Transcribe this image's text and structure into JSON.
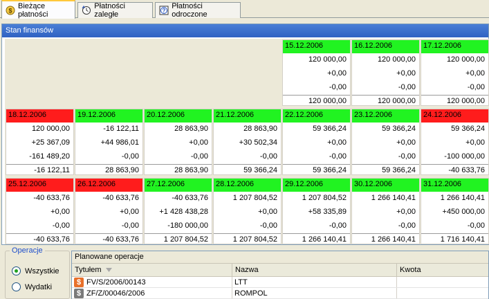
{
  "tabs": [
    {
      "label": "Bieżące płatności",
      "icon": "dollar-circle-icon"
    },
    {
      "label": "Płatności zaległe",
      "icon": "clock-arrow-icon"
    },
    {
      "label": "Płatności odroczone",
      "icon": "question-clock-icon"
    }
  ],
  "panel": {
    "title": "Stan finansów"
  },
  "days": [
    {
      "date": "15.12.2006",
      "status": "green",
      "start": "120 000,00",
      "inflow": "+0,00",
      "outflow": "-0,00",
      "end": "120 000,00"
    },
    {
      "date": "16.12.2006",
      "status": "green",
      "start": "120 000,00",
      "inflow": "+0,00",
      "outflow": "-0,00",
      "end": "120 000,00"
    },
    {
      "date": "17.12.2006",
      "status": "green",
      "start": "120 000,00",
      "inflow": "+0,00",
      "outflow": "-0,00",
      "end": "120 000,00"
    },
    {
      "date": "18.12.2006",
      "status": "red",
      "start": "120 000,00",
      "inflow": "+25 367,09",
      "outflow": "-161 489,20",
      "end": "-16 122,11"
    },
    {
      "date": "19.12.2006",
      "status": "green",
      "start": "-16 122,11",
      "inflow": "+44 986,01",
      "outflow": "-0,00",
      "end": "28 863,90"
    },
    {
      "date": "20.12.2006",
      "status": "green",
      "start": "28 863,90",
      "inflow": "+0,00",
      "outflow": "-0,00",
      "end": "28 863,90"
    },
    {
      "date": "21.12.2006",
      "status": "green",
      "start": "28 863,90",
      "inflow": "+30 502,34",
      "outflow": "-0,00",
      "end": "59 366,24"
    },
    {
      "date": "22.12.2006",
      "status": "green",
      "start": "59 366,24",
      "inflow": "+0,00",
      "outflow": "-0,00",
      "end": "59 366,24"
    },
    {
      "date": "23.12.2006",
      "status": "green",
      "start": "59 366,24",
      "inflow": "+0,00",
      "outflow": "-0,00",
      "end": "59 366,24"
    },
    {
      "date": "24.12.2006",
      "status": "red",
      "start": "59 366,24",
      "inflow": "+0,00",
      "outflow": "-100 000,00",
      "end": "-40 633,76"
    },
    {
      "date": "25.12.2006",
      "status": "red",
      "start": "-40 633,76",
      "inflow": "+0,00",
      "outflow": "-0,00",
      "end": "-40 633,76"
    },
    {
      "date": "26.12.2006",
      "status": "red",
      "start": "-40 633,76",
      "inflow": "+0,00",
      "outflow": "-0,00",
      "end": "-40 633,76"
    },
    {
      "date": "27.12.2006",
      "status": "green",
      "start": "-40 633,76",
      "inflow": "+1 428 438,28",
      "outflow": "-180 000,00",
      "end": "1 207 804,52"
    },
    {
      "date": "28.12.2006",
      "status": "green",
      "start": "1 207 804,52",
      "inflow": "+0,00",
      "outflow": "-0,00",
      "end": "1 207 804,52"
    },
    {
      "date": "29.12.2006",
      "status": "green",
      "start": "1 207 804,52",
      "inflow": "+58 335,89",
      "outflow": "-0,00",
      "end": "1 266 140,41"
    },
    {
      "date": "30.12.2006",
      "status": "green",
      "start": "1 266 140,41",
      "inflow": "+0,00",
      "outflow": "-0,00",
      "end": "1 266 140,41"
    },
    {
      "date": "31.12.2006",
      "status": "green",
      "start": "1 266 140,41",
      "inflow": "+450 000,00",
      "outflow": "-0,00",
      "end": "1 716 140,41"
    }
  ],
  "operations": {
    "legend": "Operacje",
    "options": [
      {
        "label": "Wszystkie",
        "selected": true
      },
      {
        "label": "Wydatki",
        "selected": false
      }
    ]
  },
  "planned": {
    "title": "Planowane operacje",
    "columns": [
      "Tytułem",
      "Nazwa",
      "Kwota"
    ],
    "rows": [
      {
        "icon": "dollar-orange-icon",
        "color": "#e8702a",
        "title": "FV/S/2006/00143",
        "name": "LTT",
        "amount": ""
      },
      {
        "icon": "dollar-gray-icon",
        "color": "#7a7a7a",
        "title": "ZF/Z/00046/2006",
        "name": "ROMPOL",
        "amount": ""
      }
    ]
  },
  "colors": {
    "green": "#21f321",
    "red": "#ff1c1c",
    "header": "#3a6fd0"
  }
}
